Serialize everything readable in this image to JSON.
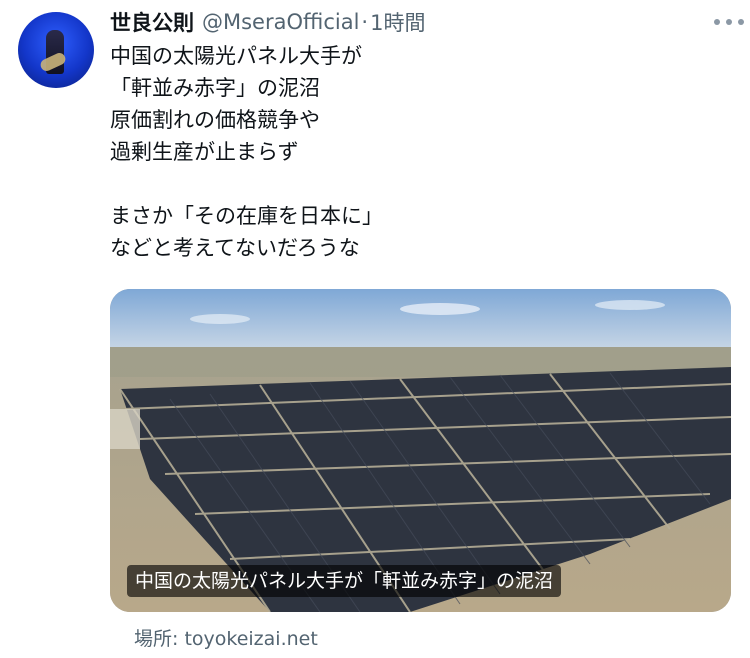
{
  "tweet": {
    "author_name": "世良公則",
    "handle": "@MseraOfficial",
    "separator": "·",
    "time": "1時間",
    "text_lines": [
      "中国の太陽光パネル大手が",
      "「軒並み赤字」の泥沼",
      "原価割れの価格競争や",
      "過剰生産が止まらず",
      "",
      "まさか「その在庫を日本に」",
      "などと考えてないだろうな"
    ]
  },
  "card": {
    "caption": "中国の太陽光パネル大手が「軒並み赤字」の泥沼",
    "source": "場所: toyokeizai.net"
  },
  "icons": {
    "more": "more-horizontal-icon",
    "avatar": "profile-avatar"
  }
}
